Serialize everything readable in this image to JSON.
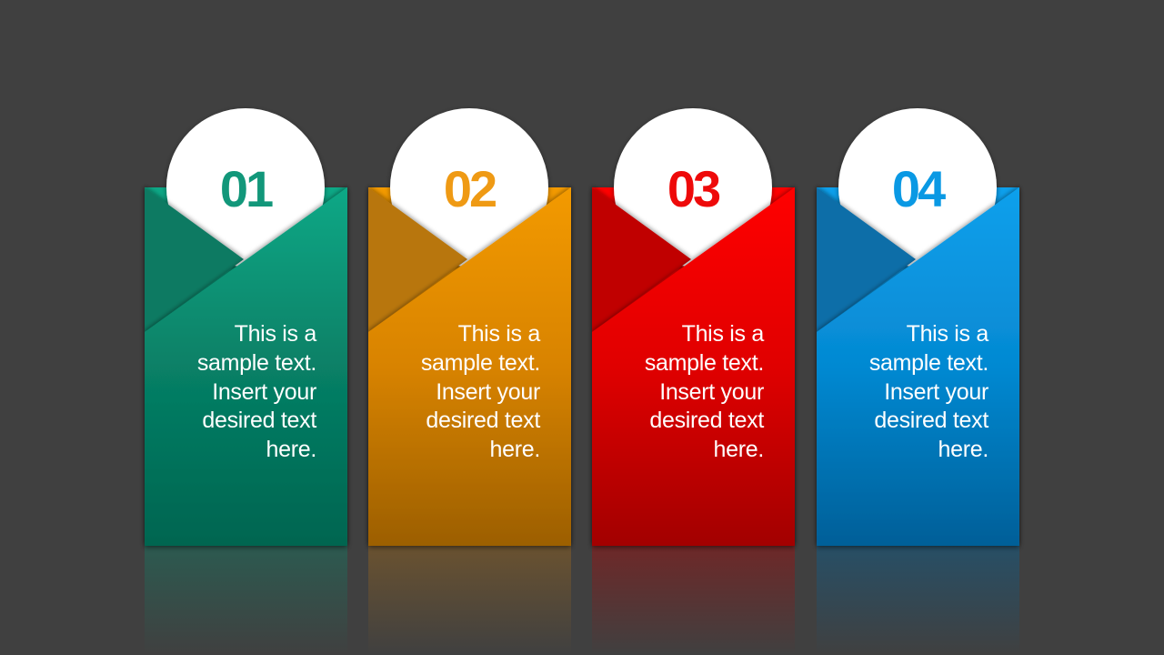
{
  "slide": {
    "background": "#404040",
    "title": ""
  },
  "cards": [
    {
      "number": "01",
      "text": "This is a sample text. Insert your desired text here.",
      "lines": [
        "This is a",
        "sample text.",
        "Insert your",
        "desired text",
        "here."
      ],
      "colors": {
        "accent": "#12977a",
        "light": "#10a886",
        "mid": "#078066",
        "dark": "#006550",
        "flap": "#0f7a62",
        "reflection": "#2c5a50"
      }
    },
    {
      "number": "02",
      "text": "This is a sample text. Insert your desired text here.",
      "lines": [
        "This is a",
        "sample text.",
        "Insert your",
        "desired text",
        "here."
      ],
      "colors": {
        "accent": "#ef9a14",
        "light": "#f39a00",
        "mid": "#d88300",
        "dark": "#9c5f05",
        "flap": "#b8760a",
        "reflection": "#6a5230"
      }
    },
    {
      "number": "03",
      "text": "This is a sample text. Insert your desired text here.",
      "lines": [
        "This is a",
        "sample text.",
        "Insert your",
        "desired text",
        "here."
      ],
      "colors": {
        "accent": "#ee0a0a",
        "light": "#ff0000",
        "mid": "#e00000",
        "dark": "#a20000",
        "flap": "#c00000",
        "reflection": "#6e2828"
      }
    },
    {
      "number": "04",
      "text": "This is a sample text. Insert your desired text here.",
      "lines": [
        "This is a",
        "sample text.",
        "Insert your",
        "desired text",
        "here."
      ],
      "colors": {
        "accent": "#0a99e4",
        "light": "#0ea0ec",
        "mid": "#0589d2",
        "dark": "#005f98",
        "flap": "#0a6ea8",
        "reflection": "#274f66"
      }
    }
  ]
}
